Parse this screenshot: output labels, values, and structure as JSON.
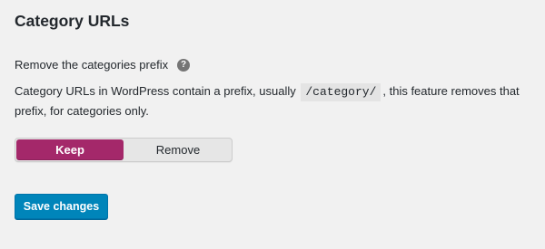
{
  "section": {
    "title": "Category URLs"
  },
  "setting": {
    "label": "Remove the categories prefix",
    "help_icon": "question-mark-icon",
    "help_glyph": "?",
    "description_before": "Category URLs in WordPress contain a prefix, usually",
    "description_code": "/category/",
    "description_after": ", this feature removes that prefix, for categories only."
  },
  "toggle": {
    "options": [
      "Keep",
      "Remove"
    ],
    "selected": "Keep",
    "active_color": "#a4286a"
  },
  "actions": {
    "save_label": "Save changes",
    "save_color": "#0085ba"
  }
}
